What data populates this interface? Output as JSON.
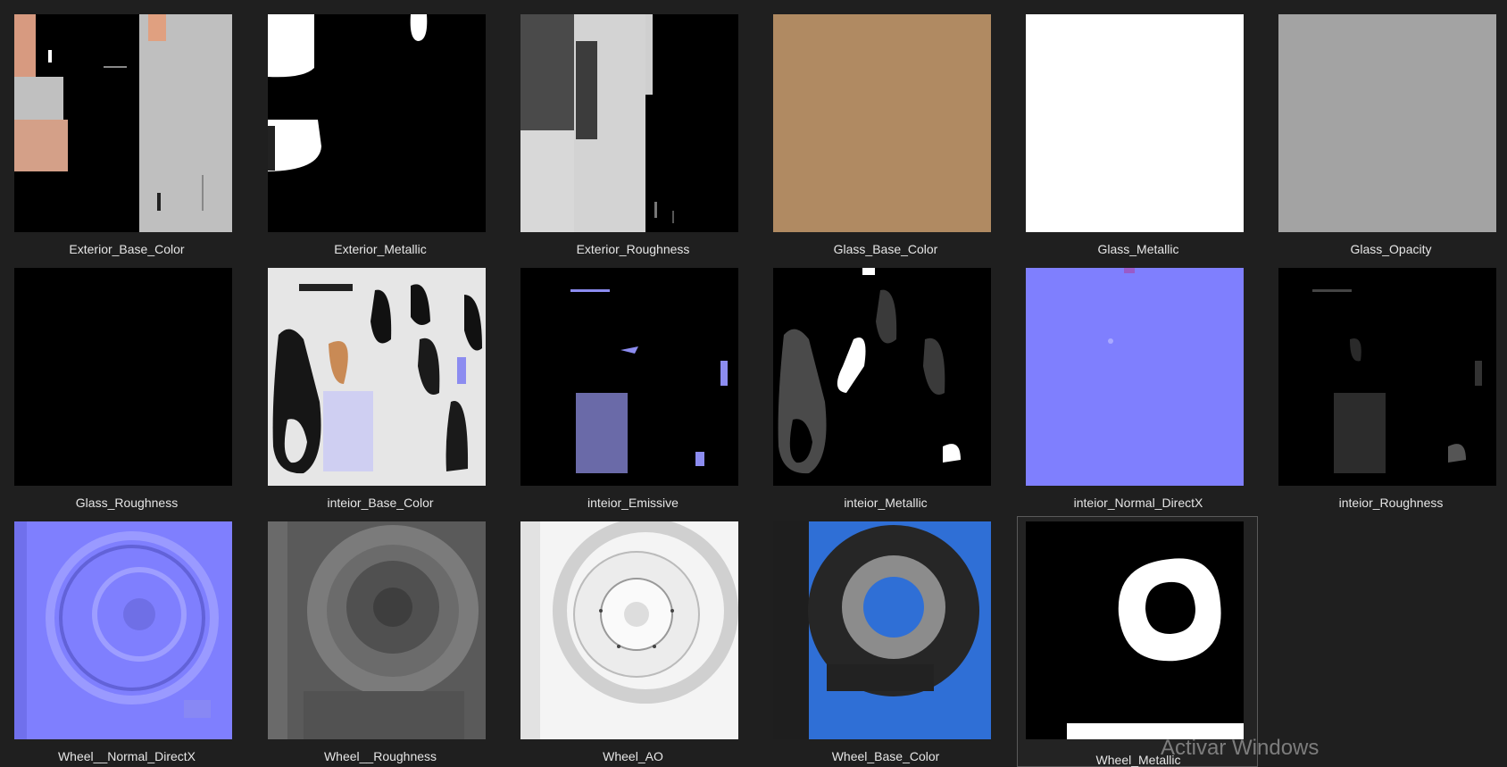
{
  "files": [
    {
      "name": "Exterior_Base_Color",
      "thumb": "exterior-base-color-thumbnail"
    },
    {
      "name": "Exterior_Metallic",
      "thumb": "exterior-metallic-thumbnail"
    },
    {
      "name": "Exterior_Roughness",
      "thumb": "exterior-roughness-thumbnail"
    },
    {
      "name": "Glass_Base_Color",
      "thumb": "glass-base-color-thumbnail"
    },
    {
      "name": "Glass_Metallic",
      "thumb": "glass-metallic-thumbnail"
    },
    {
      "name": "Glass_Opacity",
      "thumb": "glass-opacity-thumbnail"
    },
    {
      "name": "Glass_Roughness",
      "thumb": "glass-roughness-thumbnail"
    },
    {
      "name": "inteior_Base_Color",
      "thumb": "interior-base-color-thumbnail"
    },
    {
      "name": "inteior_Emissive",
      "thumb": "interior-emissive-thumbnail"
    },
    {
      "name": "inteior_Metallic",
      "thumb": "interior-metallic-thumbnail"
    },
    {
      "name": "inteior_Normal_DirectX",
      "thumb": "interior-normal-thumbnail"
    },
    {
      "name": "inteior_Roughness",
      "thumb": "interior-roughness-thumbnail"
    },
    {
      "name": "Wheel__Normal_DirectX",
      "thumb": "wheel-normal-thumbnail"
    },
    {
      "name": "Wheel__Roughness",
      "thumb": "wheel-roughness-thumbnail"
    },
    {
      "name": "Wheel_AO",
      "thumb": "wheel-ao-thumbnail"
    },
    {
      "name": "Wheel_Base_Color",
      "thumb": "wheel-base-color-thumbnail"
    },
    {
      "name": "Wheel_Metallic",
      "thumb": "wheel-metallic-thumbnail"
    }
  ],
  "selected_file": "Wheel_Metallic",
  "watermark": "Activar Windows",
  "colors": {
    "background": "#1f1f1f",
    "label": "#e6e6e6",
    "glass_base": "#b08a62",
    "glass_opacity": "#a3a3a3",
    "normal_blue": "#7f7ffe",
    "wheel_blue": "#2f6fd6"
  }
}
